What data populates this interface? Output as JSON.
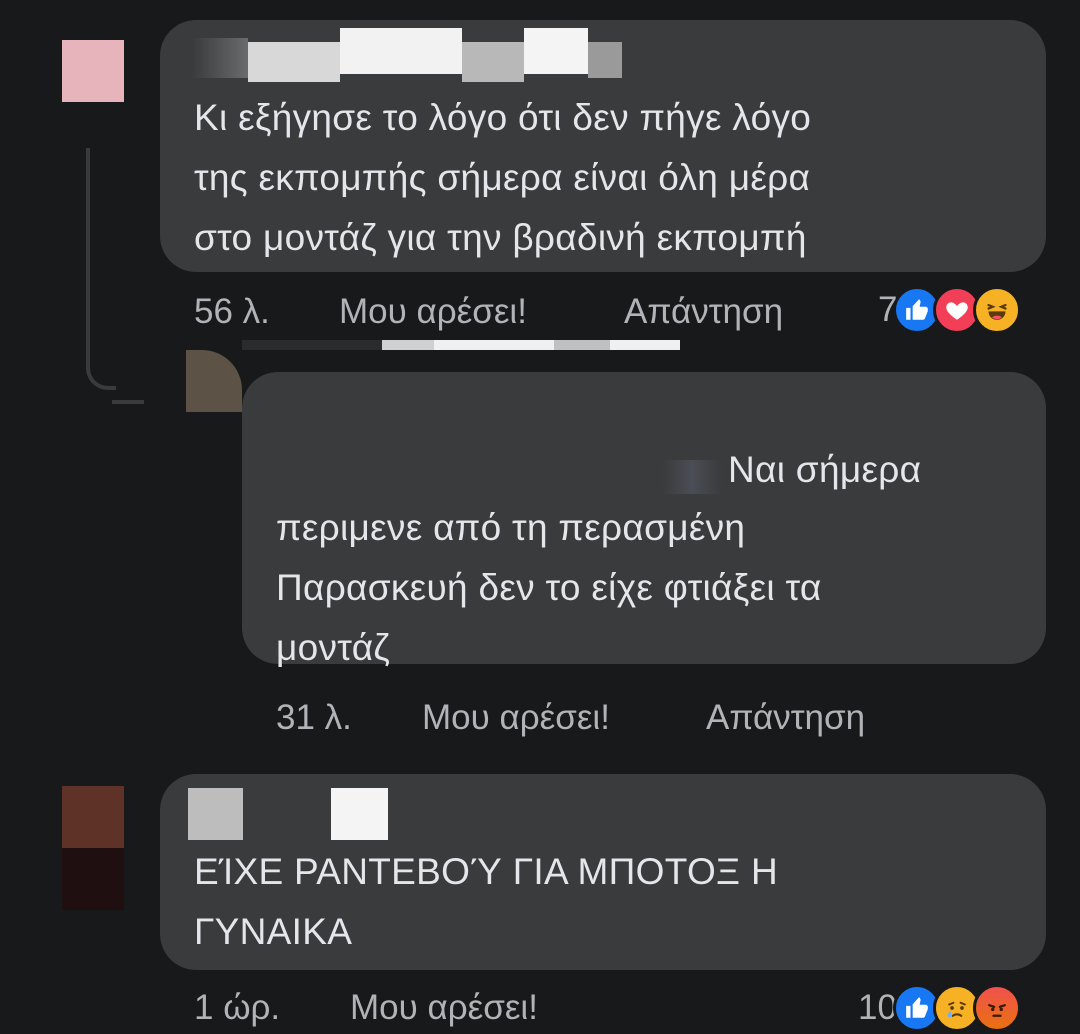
{
  "comments": [
    {
      "text": "Κι εξήγησε το λόγο ότι δεν πήγε λόγο\nτης εκπομπής σήμερα είναι όλη μέρα\nστο μοντάζ για την βραδινή εκπομπή",
      "time": "56 λ.",
      "like_label": "Μου αρέσει!",
      "reply_label": "Απάντηση",
      "reaction_count": "7",
      "reactions": [
        "like-icon",
        "love-icon",
        "haha-icon"
      ]
    },
    {
      "text_first_line": "Ναι σήμερα",
      "text": "περιμενε από τη περασμένη\nΠαρασκευή δεν το είχε φτιάξει τα\nμοντάζ",
      "time": "31 λ.",
      "like_label": "Μου αρέσει!",
      "reply_label": "Απάντηση"
    },
    {
      "text": "ΕΊΧΕ ΡΑΝΤΕΒΟΎ ΓΙΑ ΜΠΟΤΟΞ Η\nΓΥΝΑΙΚΑ",
      "time": "1 ώρ.",
      "like_label": "Μου αρέσει!",
      "reaction_count": "10",
      "reactions": [
        "like-icon",
        "sad-icon",
        "angry-icon"
      ]
    }
  ],
  "colors": {
    "background": "#18191a",
    "bubble": "#3a3b3c",
    "text": "#e4e6eb",
    "meta": "#b0b3b8",
    "like_blue": "#1877f2",
    "love_red": "#f33e58",
    "emoji_yellow": "#f7b125",
    "angry_orange": "#e9710f"
  }
}
